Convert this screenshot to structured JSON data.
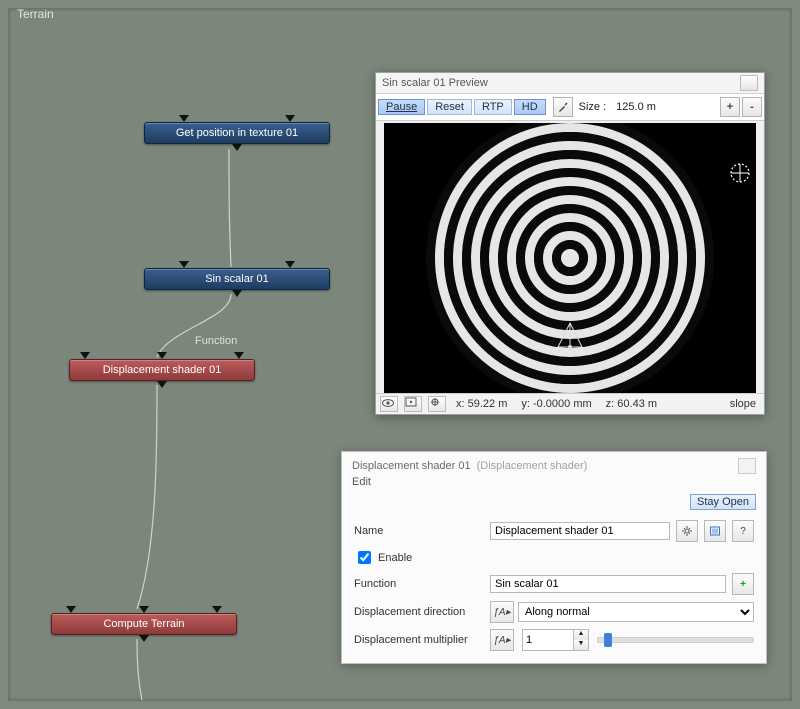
{
  "frame_title": "Terrain",
  "nodes": {
    "get_pos": {
      "label": "Get position in texture 01"
    },
    "sin": {
      "label": "Sin scalar 01"
    },
    "disp": {
      "label": "Displacement shader 01"
    },
    "compute": {
      "label": "Compute Terrain"
    }
  },
  "edges": {
    "function_label": "Function"
  },
  "preview": {
    "title": "Sin scalar 01 Preview",
    "toolbar": {
      "pause": "Pause",
      "reset": "Reset",
      "rtp": "RTP",
      "hd": "HD",
      "size_label": "Size :",
      "size_value": "125.0 m",
      "plus": "+",
      "minus": "-"
    },
    "status": {
      "x": "x: 59.22 m",
      "y": "y: -0.0000 mm",
      "z": "z: 60.43 m",
      "slope": "slope"
    }
  },
  "panel": {
    "title": "Displacement shader 01",
    "type": "(Displacement shader)",
    "menu_edit": "Edit",
    "stay_open": "Stay Open",
    "name_label": "Name",
    "name_value": "Displacement shader 01",
    "enable_label": "Enable",
    "enable_checked": true,
    "function_label": "Function",
    "function_value": "Sin scalar 01",
    "dir_label": "Displacement direction",
    "dir_value": "Along normal",
    "mult_label": "Displacement multiplier",
    "mult_value": "1",
    "help_q": "?"
  }
}
